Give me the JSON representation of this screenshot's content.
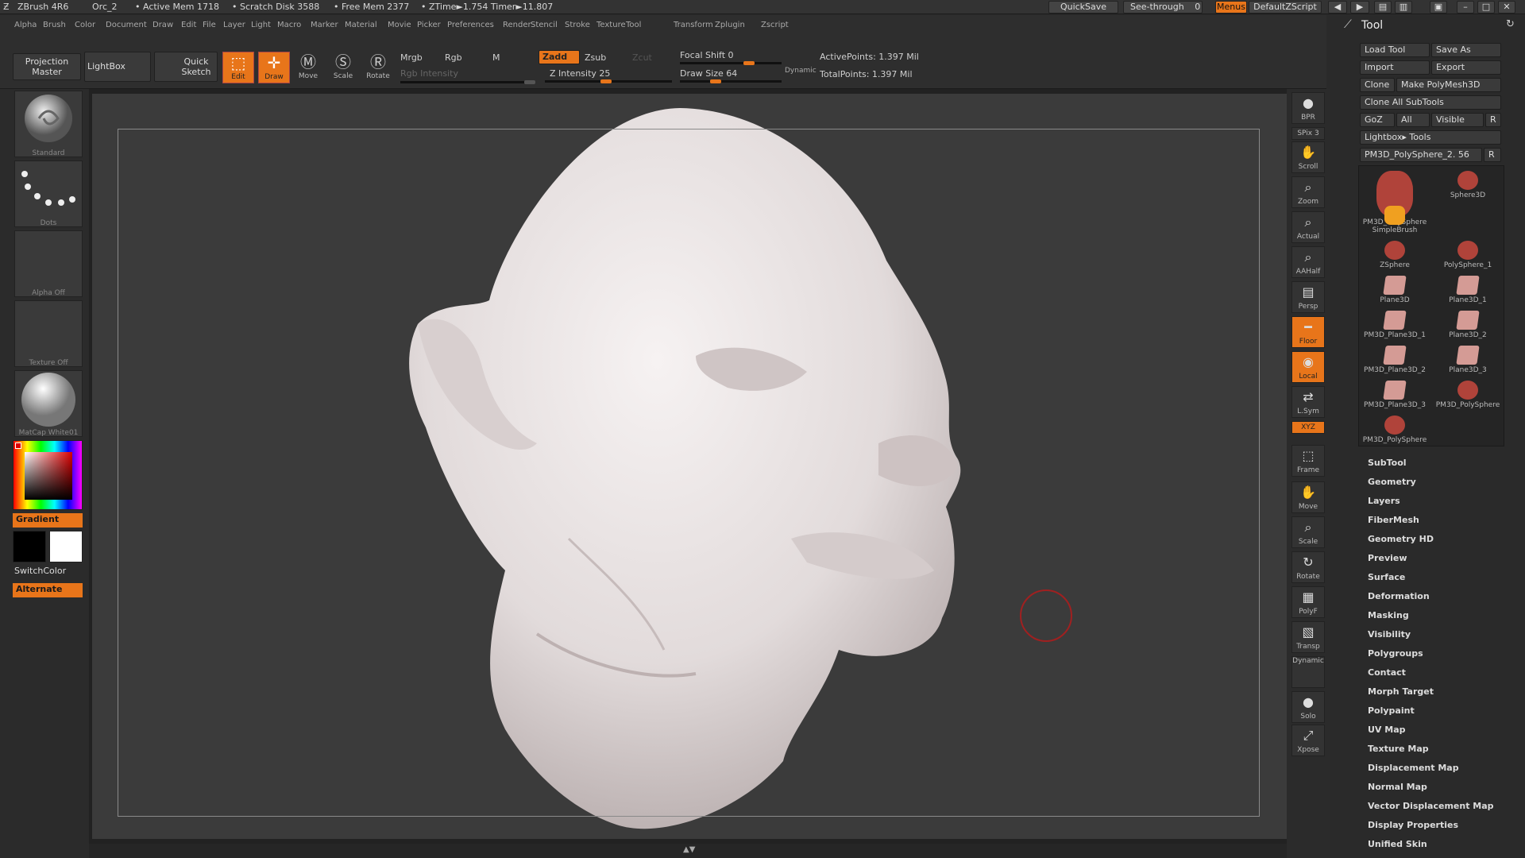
{
  "titlebar": {
    "app": "ZBrush 4R6",
    "document": "Orc_2",
    "active_mem": "• Active Mem 1718",
    "scratch_disk": "• Scratch Disk 3588",
    "free_mem": "• Free Mem 2377",
    "ztime": "• ZTime►1.754 Timer►11.807",
    "quicksave": "QuickSave",
    "see_through": "See-through",
    "see_through_value": "0",
    "menus": "Menus",
    "script": "DefaultZScript"
  },
  "menubar": [
    "Alpha",
    "Brush",
    "Color",
    "Document",
    "Draw",
    "Edit",
    "File",
    "Layer",
    "Light",
    "Macro",
    "Marker",
    "Material",
    "Movie",
    "Picker",
    "Preferences",
    "Render",
    "Stencil",
    "Stroke",
    "Texture",
    "Tool",
    "Transform",
    "Zplugin",
    "Zscript"
  ],
  "shelf": {
    "projection_master": "Projection\nMaster",
    "lightbox": "LightBox",
    "quick_sketch": "Quick\nSketch",
    "edit": "Edit",
    "draw": "Draw",
    "move": "Move",
    "scale": "Scale",
    "rotate": "Rotate",
    "mrgb": "Mrgb",
    "rgb": "Rgb",
    "m": "M",
    "rgb_intensity": "Rgb Intensity",
    "zadd": "Zadd",
    "zsub": "Zsub",
    "zcut": "Zcut",
    "z_intensity": "Z Intensity 25",
    "focal_shift": "Focal Shift 0",
    "draw_size": "Draw Size 64",
    "dynamic": "Dynamic",
    "active_points": "ActivePoints: 1.397 Mil",
    "total_points": "TotalPoints: 1.397 Mil"
  },
  "lefttray": {
    "brush": "Standard",
    "stroke": "Dots",
    "alpha": "Alpha Off",
    "texture": "Texture Off",
    "material": "MatCap White01",
    "gradient": "Gradient",
    "switchcolor": "SwitchColor",
    "alternate": "Alternate"
  },
  "rightshelf": [
    {
      "label": "BPR",
      "icon": "●"
    },
    {
      "label": "SPix 3",
      "icon": ""
    },
    {
      "label": "Scroll",
      "icon": "✋"
    },
    {
      "label": "Zoom",
      "icon": "⌕"
    },
    {
      "label": "Actual",
      "icon": "⌕"
    },
    {
      "label": "AAHalf",
      "icon": "⌕"
    },
    {
      "label": "Persp",
      "icon": "▤"
    },
    {
      "label": "Floor",
      "icon": "━"
    },
    {
      "label": "Local",
      "icon": "◉"
    },
    {
      "label": "L.Sym",
      "icon": "⇄"
    },
    {
      "label": "XYZ",
      "icon": ""
    },
    {
      "label": "Frame",
      "icon": "⬚"
    },
    {
      "label": "Move",
      "icon": "✋"
    },
    {
      "label": "Scale",
      "icon": "⌕"
    },
    {
      "label": "Rotate",
      "icon": "↻"
    },
    {
      "label": "PolyF",
      "icon": "▦"
    },
    {
      "label": "Transp",
      "icon": "▧"
    },
    {
      "label": "Dynamic",
      "icon": ""
    },
    {
      "label": "Solo",
      "icon": "●"
    },
    {
      "label": "Xpose",
      "icon": "⤢"
    }
  ],
  "tool": {
    "title": "Tool",
    "load_tool": "Load Tool",
    "save_as": "Save As",
    "import": "Import",
    "export": "Export",
    "clone": "Clone",
    "make_polymesh": "Make PolyMesh3D",
    "clone_all": "Clone All SubTools",
    "goz": "GoZ",
    "all": "All",
    "visible": "Visible",
    "r": "R",
    "lightbox_tools": "Lightbox▸ Tools",
    "current_tool": "PM3D_PolySphere_2. 56",
    "tools": [
      {
        "name": "PM3D_PolySphere",
        "kind": "head"
      },
      {
        "name": "Sphere3D",
        "kind": "sphere"
      },
      {
        "name": "SimpleBrush",
        "kind": "brush"
      },
      {
        "name": "ZSphere",
        "kind": "sphere"
      },
      {
        "name": "PolySphere_1",
        "kind": "sphere"
      },
      {
        "name": "Plane3D",
        "kind": "plane"
      },
      {
        "name": "Plane3D_1",
        "kind": "plane"
      },
      {
        "name": "PM3D_Plane3D_1",
        "kind": "plane"
      },
      {
        "name": "Plane3D_2",
        "kind": "plane"
      },
      {
        "name": "PM3D_Plane3D_2",
        "kind": "plane"
      },
      {
        "name": "Plane3D_3",
        "kind": "plane"
      },
      {
        "name": "PM3D_Plane3D_3",
        "kind": "plane"
      },
      {
        "name": "PM3D_PolySphere",
        "kind": "sphere"
      },
      {
        "name": "PM3D_PolySphere",
        "kind": "sphere"
      }
    ],
    "submenus": [
      "SubTool",
      "Geometry",
      "Layers",
      "FiberMesh",
      "Geometry HD",
      "Preview",
      "Surface",
      "Deformation",
      "Masking",
      "Visibility",
      "Polygroups",
      "Contact",
      "Morph Target",
      "Polypaint",
      "UV Map",
      "Texture Map",
      "Displacement Map",
      "Normal Map",
      "Vector Displacement Map",
      "Display Properties",
      "Unified Skin"
    ]
  },
  "colors": {
    "accent": "#e8751a",
    "panel": "#2e2e2e",
    "canvas": "#3b3b3b"
  }
}
